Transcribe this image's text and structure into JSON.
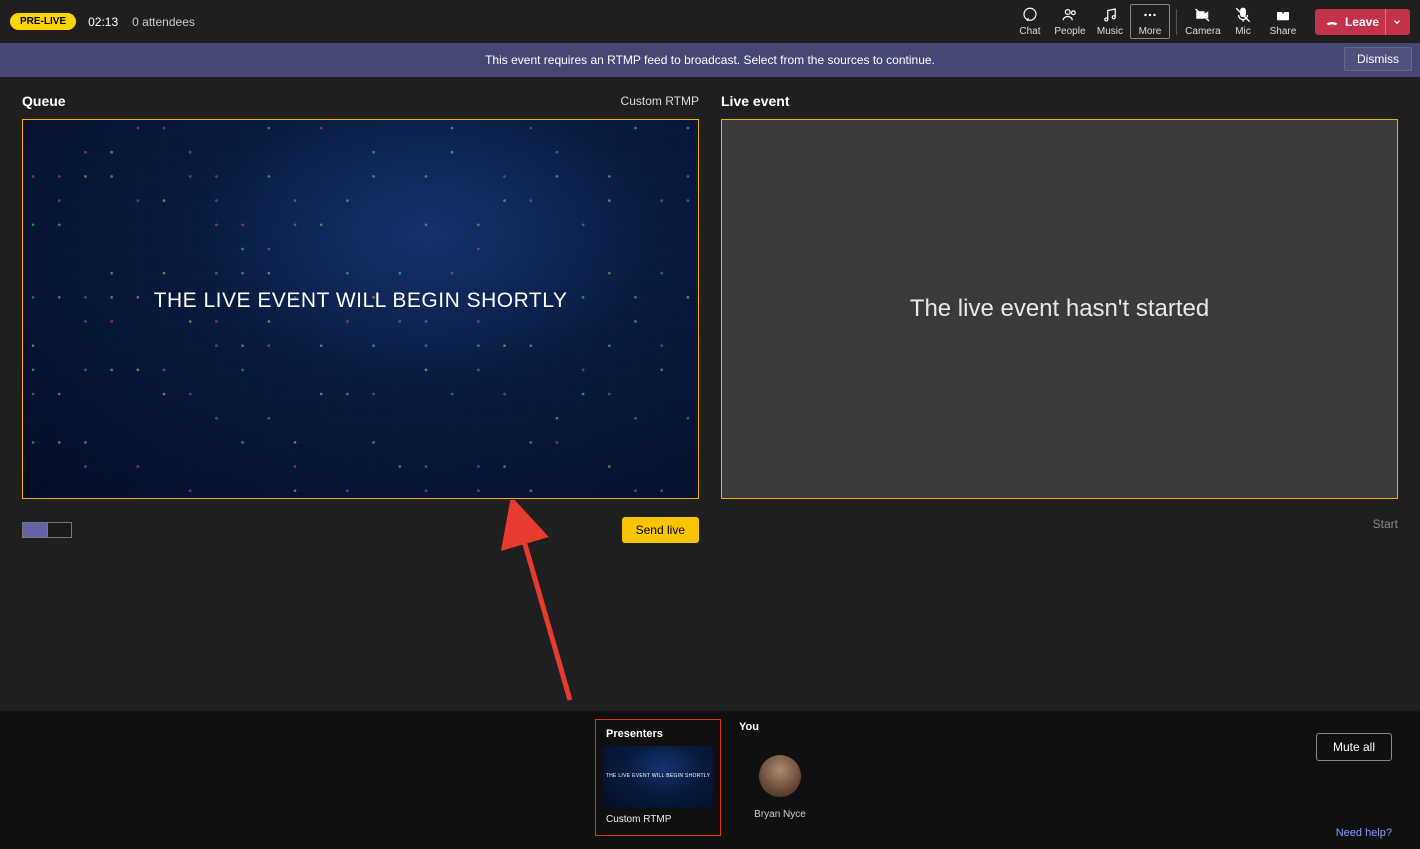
{
  "topbar": {
    "status_badge": "PRE-LIVE",
    "timer": "02:13",
    "attendees": "0 attendees",
    "buttons": {
      "chat": "Chat",
      "people": "People",
      "music": "Music",
      "more": "More",
      "camera": "Camera",
      "mic": "Mic",
      "share": "Share"
    },
    "leave": "Leave"
  },
  "banner": {
    "message": "This event requires an RTMP feed to broadcast. Select from the sources to continue.",
    "dismiss": "Dismiss"
  },
  "queue": {
    "title": "Queue",
    "source_label": "Custom RTMP",
    "overlay_text": "THE LIVE EVENT WILL BEGIN SHORTLY",
    "send_live": "Send live"
  },
  "live": {
    "title": "Live event",
    "message": "The live event hasn't started",
    "start": "Start"
  },
  "tray": {
    "presenters_title": "Presenters",
    "presenter_source": "Custom RTMP",
    "you_title": "You",
    "you_name": "Bryan Nyce",
    "mute_all": "Mute all",
    "need_help": "Need help?"
  }
}
